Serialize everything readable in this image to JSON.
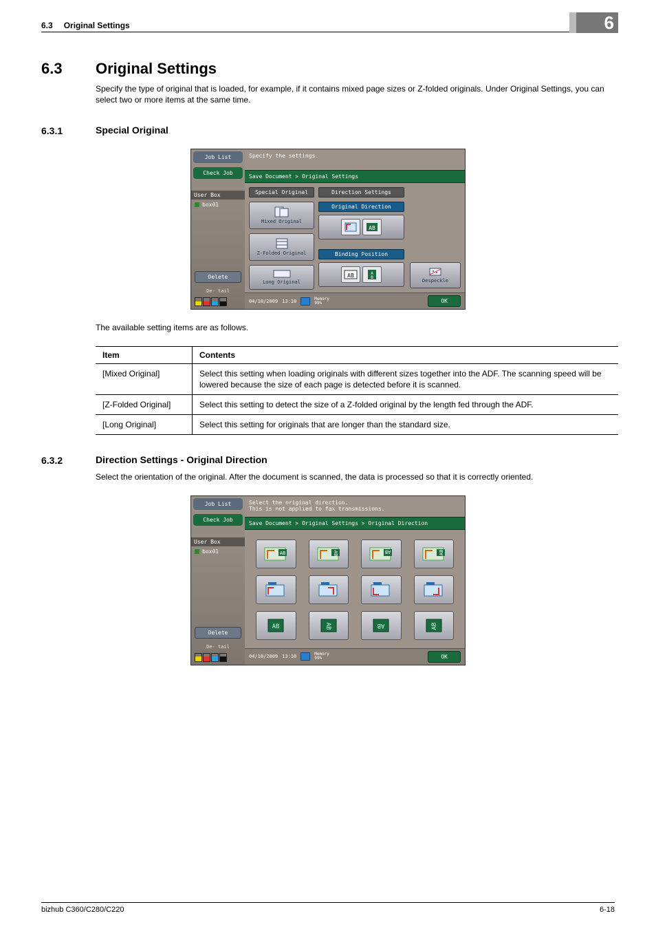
{
  "chapter_tab": "6",
  "header": {
    "sec_num": "6.3",
    "title": "Original Settings"
  },
  "section": {
    "num": "6.3",
    "title": "Original Settings",
    "intro": "Specify the type of original that is loaded, for example, if it contains mixed page sizes or Z-folded originals. Under Original Settings, you can select two or more items at the same time."
  },
  "sub1": {
    "num": "6.3.1",
    "title": "Special Original",
    "after_para": "The available setting items are as follows."
  },
  "screenshot1": {
    "sidebar": {
      "job_list": "Job List",
      "check_job": "Check Job",
      "user_box": "User Box",
      "box_item": "box01",
      "delete": "Delete",
      "detail": "De-\ntail"
    },
    "message": "Specify the settings.",
    "breadcrumb": "Save Document > Original Settings",
    "col_special": "Special\nOriginal",
    "col_direction": "Direction Settings",
    "btn_mixed": "Mixed Original",
    "btn_zfold": "Z-Folded\nOriginal",
    "btn_long": "Long\nOriginal",
    "lbl_orig_dir": "Original Direction",
    "lbl_bind_pos": "Binding Position",
    "btn_despeckle": "Despeckle",
    "status": {
      "date": "04/10/2009",
      "time": "13:10",
      "memory_label": "Memory",
      "memory_value": "99%",
      "ok": "OK"
    }
  },
  "table": {
    "h_item": "Item",
    "h_contents": "Contents",
    "rows": [
      {
        "item": "[Mixed Original]",
        "contents": "Select this setting when loading originals with different sizes together into the ADF. The scanning speed will be lowered because the size of each page is detected before it is scanned."
      },
      {
        "item": "[Z-Folded Original]",
        "contents": "Select this setting to detect the size of a Z-folded original by the length fed through the ADF."
      },
      {
        "item": "[Long Original]",
        "contents": "Select this setting for originals that are longer than the standard size."
      }
    ]
  },
  "sub2": {
    "num": "6.3.2",
    "title": "Direction Settings - Original Direction",
    "intro": "Select the orientation of the original. After the document is scanned, the data is processed so that it is correctly oriented."
  },
  "screenshot2": {
    "sidebar": {
      "job_list": "Job List",
      "check_job": "Check Job",
      "user_box": "User Box",
      "box_item": "box01",
      "delete": "Delete",
      "detail": "De-\ntail"
    },
    "message": "Select the original direction.\nThis is not applied to fax transmissions.",
    "breadcrumb": "Save Document > Original Settings > Original Direction",
    "status": {
      "date": "04/10/2009",
      "time": "13:10",
      "memory_label": "Memory",
      "memory_value": "99%",
      "ok": "OK"
    }
  },
  "footer": {
    "left": "bizhub C360/C280/C220",
    "right": "6-18"
  }
}
